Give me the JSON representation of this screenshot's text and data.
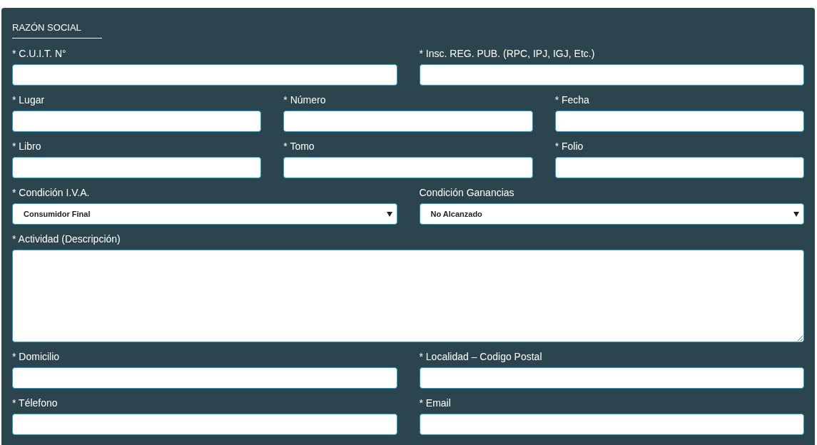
{
  "section_title": "RAZÓN SOCIAL",
  "rows": [
    [
      {
        "label": "* C.U.I.T. N°",
        "kind": "text"
      },
      {
        "label": "* Insc. REG. PUB. (RPC, IPJ, IGJ, Etc.)",
        "kind": "text"
      }
    ],
    [
      {
        "label": "* Lugar",
        "kind": "text"
      },
      {
        "label": "* Número",
        "kind": "text"
      },
      {
        "label": "* Fecha",
        "kind": "text"
      }
    ],
    [
      {
        "label": "* Libro",
        "kind": "text"
      },
      {
        "label": "* Tomo",
        "kind": "text"
      },
      {
        "label": "* Folio",
        "kind": "text"
      }
    ],
    [
      {
        "label": "* Condición I.V.A.",
        "kind": "select",
        "value": "Consumidor Final"
      },
      {
        "label": "Condición Ganancias",
        "kind": "select",
        "value": "No Alcanzado"
      }
    ],
    [
      {
        "label": "* Actividad (Descripción)",
        "kind": "textarea"
      }
    ],
    [
      {
        "label": "* Domicilio",
        "kind": "text"
      },
      {
        "label": "* Localidad – Codigo Postal",
        "kind": "text"
      }
    ],
    [
      {
        "label": "* Télefono",
        "kind": "text"
      },
      {
        "label": "* Email",
        "kind": "text"
      }
    ]
  ]
}
